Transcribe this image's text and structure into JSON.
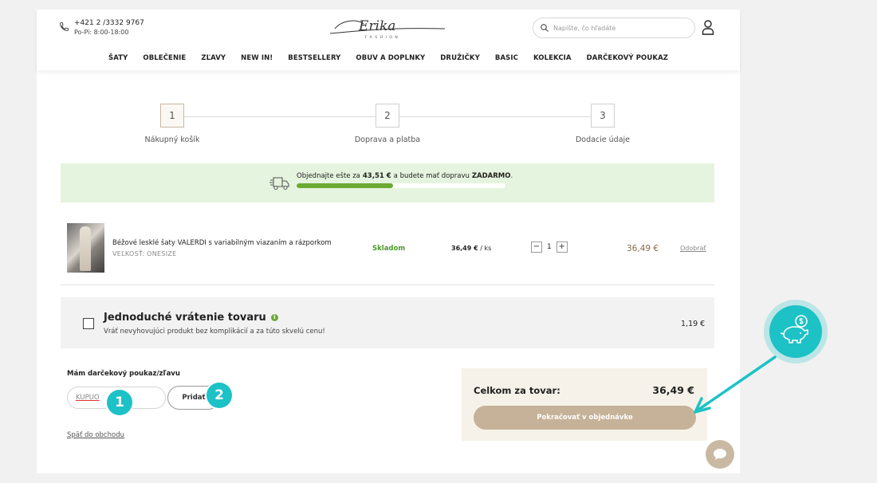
{
  "header": {
    "phone": "+421 2 /3332 9767",
    "hours": "Po-Pi: 8:00-18:00",
    "logo": "Erika",
    "logo_sub": "FASHION",
    "search_placeholder": "Napíšte, čo hľadáte"
  },
  "nav": [
    "ŠATY",
    "OBLEČENIE",
    "ZĽAVY",
    "NEW IN!",
    "BESTSELLERY",
    "OBUV A DOPLNKY",
    "DRUŽIČKY",
    "BASIC",
    "KOLEKCIA",
    "DARČEKOVÝ POUKAZ"
  ],
  "steps": [
    {
      "num": "1",
      "label": "Nákupný košík"
    },
    {
      "num": "2",
      "label": "Doprava a platba"
    },
    {
      "num": "3",
      "label": "Dodacie údaje"
    }
  ],
  "shipping": {
    "text_before": "Objednajte ešte za",
    "amount": "43,51 €",
    "text_middle": "a budete mať dopravu",
    "text_free": "ZADARMO",
    "text_end": ".",
    "progress": 0.46
  },
  "item": {
    "name": "Béžové lesklé šaty VALERDI s variabilným viazaním a rázporkom",
    "size": "VEĽKOSŤ: ONESIZE",
    "stock": "Skladom",
    "unit_price": "36,49 €",
    "unit": "/ ks",
    "quantity": "1",
    "line_price": "36,49 €",
    "remove_label": "Odobrať"
  },
  "return_option": {
    "title": "Jednoduché vrátenie tovaru",
    "description": "Vráť nevyhovujúci produkt bez komplikácií a za túto skvelú cenu!",
    "price": "1,19 €"
  },
  "voucher": {
    "label": "Mám darčekový poukaz/zľavu",
    "value": "KUPUO",
    "button": "Pridať",
    "badge_1": "1",
    "badge_2": "2"
  },
  "back_link": "Späť do obchodu",
  "summary": {
    "label": "Celkom za tovar:",
    "total": "36,49 €",
    "button": "Pokračovať v objednávke"
  },
  "colors": {
    "accent": "#1cc2c6",
    "green": "#6aaa32",
    "button": "#c5b298"
  }
}
